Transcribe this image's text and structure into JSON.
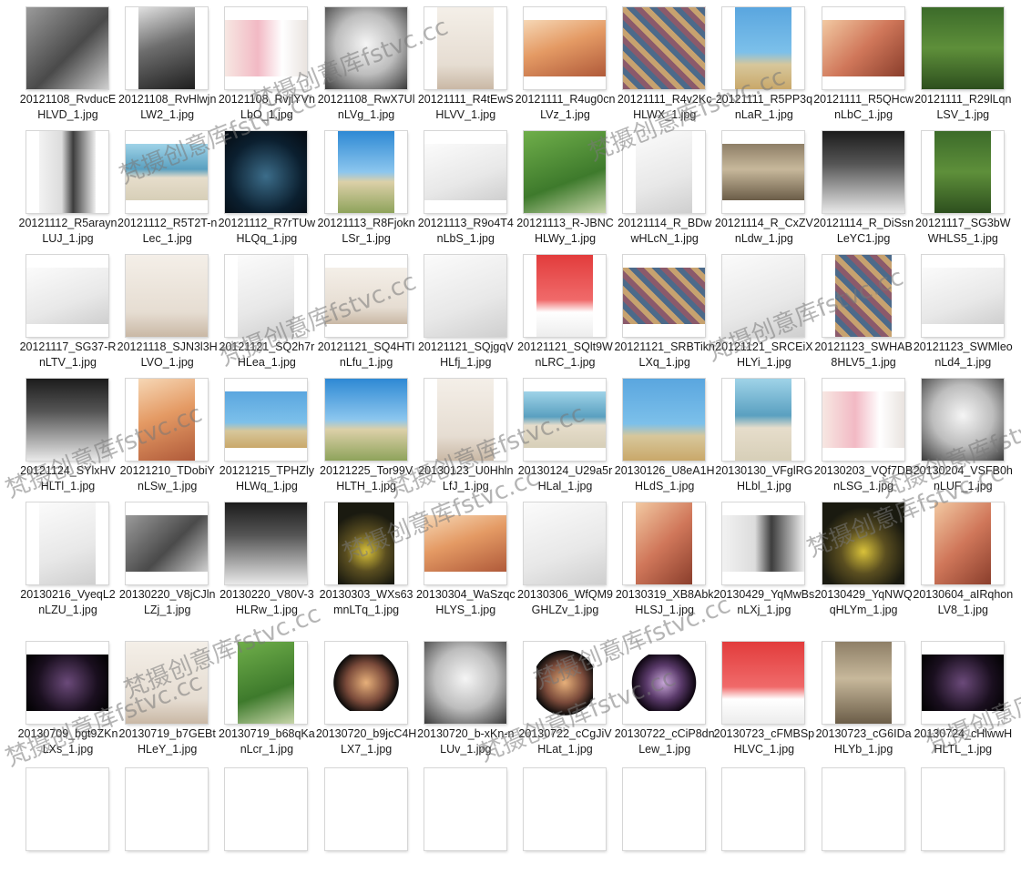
{
  "files": [
    {
      "name": "20121108_RvducEHLVD_1.jpg",
      "style": "bw1"
    },
    {
      "name": "20121108_RvHlwjnLW2_1.jpg",
      "style": "bw2"
    },
    {
      "name": "20121108_RvjlYVnLbO_1.jpg",
      "style": "pink"
    },
    {
      "name": "20121108_RwX7UlnLVg_1.jpg",
      "style": "bw3"
    },
    {
      "name": "20121111_R4tEwSHLVV_1.jpg",
      "style": "pale2"
    },
    {
      "name": "20121111_R4ug0cnLVz_1.jpg",
      "style": "warm2"
    },
    {
      "name": "20121111_R4v2KcHLWX_1.jpg",
      "style": "rug"
    },
    {
      "name": "20121111_R5PP3qnLaR_1.jpg",
      "style": "sky1"
    },
    {
      "name": "20121111_R5QHcwnLbC_1.jpg",
      "style": "warm1"
    },
    {
      "name": "20121111_R29lLqnLSV_1.jpg",
      "style": "green1"
    },
    {
      "name": "20121112_R5araynLUJ_1.jpg",
      "style": "bw5"
    },
    {
      "name": "20121112_R5T2T-nLec_1.jpg",
      "style": "sea"
    },
    {
      "name": "20121112_R7rTUwHLQq_1.jpg",
      "style": "dark1"
    },
    {
      "name": "20121113_R8FjoknLSr_1.jpg",
      "style": "sky2"
    },
    {
      "name": "20121113_R9o4T4nLbS_1.jpg",
      "style": "pale1"
    },
    {
      "name": "20121113_R-JBNCHLWy_1.jpg",
      "style": "green2"
    },
    {
      "name": "20121114_R_BDwwHLcN_1.jpg",
      "style": "pale1"
    },
    {
      "name": "20121114_R_CxZVnLdw_1.jpg",
      "style": "stone"
    },
    {
      "name": "20121114_R_DiSsnLeYC1.jpg",
      "style": "bw4"
    },
    {
      "name": "20121117_SG3bWWHLS5_1.jpg",
      "style": "green1"
    },
    {
      "name": "20121117_SG37-RnLTV_1.jpg",
      "style": "pale1"
    },
    {
      "name": "20121118_SJN3l3HLVO_1.jpg",
      "style": "pale2"
    },
    {
      "name": "20121121_SQ2h7rHLea_1.jpg",
      "style": "pale1"
    },
    {
      "name": "20121121_SQ4HTInLfu_1.jpg",
      "style": "pale2"
    },
    {
      "name": "20121121_SQjgqVHLfj_1.jpg",
      "style": "pale1"
    },
    {
      "name": "20121121_SQlt9WnLRC_1.jpg",
      "style": "red1"
    },
    {
      "name": "20121121_SRBTiknLXq_1.jpg",
      "style": "rug"
    },
    {
      "name": "20121121_SRCEiXHLYi_1.jpg",
      "style": "pale1"
    },
    {
      "name": "20121123_SWHAB8HLV5_1.jpg",
      "style": "rug"
    },
    {
      "name": "20121123_SWMleonLd4_1.jpg",
      "style": "pale1"
    },
    {
      "name": "20121124_SYlxHVHLTl_1.jpg",
      "style": "bw4"
    },
    {
      "name": "20121210_TDobiYnLSw_1.jpg",
      "style": "warm2"
    },
    {
      "name": "20121215_TPHZlyHLWq_1.jpg",
      "style": "sky1"
    },
    {
      "name": "20121225_Tor99VHLTH_1.jpg",
      "style": "sky2"
    },
    {
      "name": "20130123_U0HhlnLfJ_1.jpg",
      "style": "pale2"
    },
    {
      "name": "20130124_U29a5rHLal_1.jpg",
      "style": "sea"
    },
    {
      "name": "20130126_U8eA1HHLdS_1.jpg",
      "style": "sky1"
    },
    {
      "name": "20130130_VFglRGHLbl_1.jpg",
      "style": "sea"
    },
    {
      "name": "20130203_VQf7DBnLSG_1.jpg",
      "style": "pink"
    },
    {
      "name": "20130204_VSFB0hnLUF_1.jpg",
      "style": "bw3"
    },
    {
      "name": "20130216_VyeqL2nLZU_1.jpg",
      "style": "pale1"
    },
    {
      "name": "20130220_V8jCJlnLZj_1.jpg",
      "style": "bw1"
    },
    {
      "name": "20130220_V80V-3HLRw_1.jpg",
      "style": "bw4"
    },
    {
      "name": "20130303_WXs63mnLTq_1.jpg",
      "style": "night"
    },
    {
      "name": "20130304_WaSzqcHLYS_1.jpg",
      "style": "warm2"
    },
    {
      "name": "20130306_WfQM9GHLZv_1.jpg",
      "style": "pale1"
    },
    {
      "name": "20130319_XB8AbkHLSJ_1.jpg",
      "style": "warm1"
    },
    {
      "name": "20130429_YqMwBsnLXj_1.jpg",
      "style": "bw5"
    },
    {
      "name": "20130429_YqNWQqHLYm_1.jpg",
      "style": "night"
    },
    {
      "name": "20130604_aIRqhonLV8_1.jpg",
      "style": "warm1"
    },
    {
      "name": "20130709_bgt9ZKnLXs_1.jpg",
      "style": "dark2"
    },
    {
      "name": "20130719_b7GEBtHLeY_1.jpg",
      "style": "pale2"
    },
    {
      "name": "20130719_b68qKanLcr_1.jpg",
      "style": "green2"
    },
    {
      "name": "20130720_b9jcC4HLX7_1.jpg",
      "style": "fish"
    },
    {
      "name": "20130720_b-xKn-nLUv_1.jpg",
      "style": "bw3"
    },
    {
      "name": "20130722_cCgJiVHLat_1.jpg",
      "style": "fish"
    },
    {
      "name": "20130722_cCiP8dnLew_1.jpg",
      "style": "fish2"
    },
    {
      "name": "20130723_cFMBSpHLVC_1.jpg",
      "style": "red1"
    },
    {
      "name": "20130723_cG6IDaHLYb_1.jpg",
      "style": "stone"
    },
    {
      "name": "20130724_cHlwwHHLTL_1.jpg",
      "style": "dark2"
    }
  ],
  "watermark": "梵摄创意库fstvc.cc"
}
